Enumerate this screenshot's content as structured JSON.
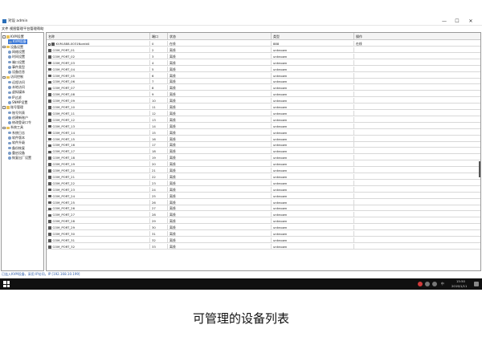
{
  "window": {
    "title": "对设 admin",
    "min_label": "—",
    "max_label": "☐",
    "close_label": "✕"
  },
  "menubar": {
    "items": [
      {
        "label": "文件"
      },
      {
        "label": "视图管理"
      },
      {
        "label": "平台管理"
      },
      {
        "label": "帮助"
      }
    ]
  },
  "tree": {
    "nodes": [
      {
        "label": "KVM设置",
        "level": 0,
        "type": "folder",
        "selected": false,
        "expander": true
      },
      {
        "label": "KVM设备",
        "level": 1,
        "type": "gear",
        "selected": true,
        "expander": false
      },
      {
        "label": "设备设置",
        "level": 0,
        "type": "folder",
        "selected": false,
        "expander": true
      },
      {
        "label": "网络设置",
        "level": 1,
        "type": "gear",
        "selected": false,
        "expander": false
      },
      {
        "label": "时间设置",
        "level": 1,
        "type": "gear",
        "selected": false,
        "expander": false
      },
      {
        "label": "端口设置",
        "level": 1,
        "type": "gear",
        "selected": false,
        "expander": false
      },
      {
        "label": "事件类型",
        "level": 1,
        "type": "gear",
        "selected": false,
        "expander": false
      },
      {
        "label": "设备信息",
        "level": 1,
        "type": "gear",
        "selected": false,
        "expander": false
      },
      {
        "label": "访问控制",
        "level": 0,
        "type": "folder",
        "selected": false,
        "expander": true
      },
      {
        "label": "远程访问",
        "level": 1,
        "type": "gear",
        "selected": false,
        "expander": false
      },
      {
        "label": "本地访问",
        "level": 1,
        "type": "gear",
        "selected": false,
        "expander": false
      },
      {
        "label": "虚拟媒体",
        "level": 1,
        "type": "gear",
        "selected": false,
        "expander": false
      },
      {
        "label": "IP过滤",
        "level": 1,
        "type": "gear",
        "selected": false,
        "expander": false
      },
      {
        "label": "SNMP设置",
        "level": 1,
        "type": "gear",
        "selected": false,
        "expander": false
      },
      {
        "label": "账号管理",
        "level": 0,
        "type": "folder",
        "selected": false,
        "expander": true
      },
      {
        "label": "账号列表",
        "level": 1,
        "type": "gear",
        "selected": false,
        "expander": false
      },
      {
        "label": "创建新账户",
        "level": 1,
        "type": "gear",
        "selected": false,
        "expander": false
      },
      {
        "label": "修改登录口令",
        "level": 1,
        "type": "gear",
        "selected": false,
        "expander": false
      },
      {
        "label": "系统工具",
        "level": 0,
        "type": "folder",
        "selected": false,
        "expander": true
      },
      {
        "label": "系统日志",
        "level": 1,
        "type": "gear",
        "selected": false,
        "expander": false
      },
      {
        "label": "软件版本",
        "level": 1,
        "type": "gear",
        "selected": false,
        "expander": false
      },
      {
        "label": "软件升级",
        "level": 1,
        "type": "gear",
        "selected": false,
        "expander": false
      },
      {
        "label": "备份恢复",
        "level": 1,
        "type": "gear",
        "selected": false,
        "expander": false
      },
      {
        "label": "重启设备",
        "level": 1,
        "type": "gear",
        "selected": false,
        "expander": false
      },
      {
        "label": "恢复出厂设置",
        "level": 1,
        "type": "gear",
        "selected": false,
        "expander": false
      }
    ]
  },
  "table": {
    "columns": [
      {
        "label": "名称"
      },
      {
        "label": "端口"
      },
      {
        "label": "状态"
      },
      {
        "label": "类型"
      },
      {
        "label": "操作"
      }
    ],
    "rows": [
      {
        "name": "KVM-888-0031Nordd4",
        "port": "0",
        "status": "在线",
        "type": "888",
        "action": "在线"
      },
      {
        "name": "COM_PORT_01",
        "port": "2",
        "status": "离线",
        "type": "unknown",
        "action": ""
      },
      {
        "name": "COM_PORT_02",
        "port": "3",
        "status": "离线",
        "type": "unknown",
        "action": ""
      },
      {
        "name": "COM_PORT_03",
        "port": "4",
        "status": "离线",
        "type": "unknown",
        "action": ""
      },
      {
        "name": "COM_PORT_04",
        "port": "5",
        "status": "离线",
        "type": "unknown",
        "action": ""
      },
      {
        "name": "COM_PORT_05",
        "port": "6",
        "status": "离线",
        "type": "unknown",
        "action": ""
      },
      {
        "name": "COM_PORT_06",
        "port": "7",
        "status": "离线",
        "type": "unknown",
        "action": ""
      },
      {
        "name": "COM_PORT_07",
        "port": "8",
        "status": "离线",
        "type": "unknown",
        "action": ""
      },
      {
        "name": "COM_PORT_08",
        "port": "9",
        "status": "离线",
        "type": "unknown",
        "action": ""
      },
      {
        "name": "COM_PORT_09",
        "port": "10",
        "status": "离线",
        "type": "unknown",
        "action": ""
      },
      {
        "name": "COM_PORT_10",
        "port": "11",
        "status": "离线",
        "type": "unknown",
        "action": ""
      },
      {
        "name": "COM_PORT_11",
        "port": "12",
        "status": "离线",
        "type": "unknown",
        "action": ""
      },
      {
        "name": "COM_PORT_12",
        "port": "13",
        "status": "离线",
        "type": "unknown",
        "action": ""
      },
      {
        "name": "COM_PORT_13",
        "port": "14",
        "status": "离线",
        "type": "unknown",
        "action": ""
      },
      {
        "name": "COM_PORT_14",
        "port": "15",
        "status": "离线",
        "type": "unknown",
        "action": ""
      },
      {
        "name": "COM_PORT_15",
        "port": "16",
        "status": "离线",
        "type": "unknown",
        "action": ""
      },
      {
        "name": "COM_PORT_16",
        "port": "17",
        "status": "离线",
        "type": "unknown",
        "action": ""
      },
      {
        "name": "COM_PORT_17",
        "port": "18",
        "status": "离线",
        "type": "unknown",
        "action": ""
      },
      {
        "name": "COM_PORT_18",
        "port": "19",
        "status": "离线",
        "type": "unknown",
        "action": ""
      },
      {
        "name": "COM_PORT_19",
        "port": "20",
        "status": "离线",
        "type": "unknown",
        "action": ""
      },
      {
        "name": "COM_PORT_20",
        "port": "21",
        "status": "离线",
        "type": "unknown",
        "action": ""
      },
      {
        "name": "COM_PORT_21",
        "port": "22",
        "status": "离线",
        "type": "unknown",
        "action": ""
      },
      {
        "name": "COM_PORT_22",
        "port": "23",
        "status": "离线",
        "type": "unknown",
        "action": ""
      },
      {
        "name": "COM_PORT_23",
        "port": "24",
        "status": "离线",
        "type": "unknown",
        "action": ""
      },
      {
        "name": "COM_PORT_24",
        "port": "25",
        "status": "离线",
        "type": "unknown",
        "action": ""
      },
      {
        "name": "COM_PORT_25",
        "port": "26",
        "status": "离线",
        "type": "unknown",
        "action": ""
      },
      {
        "name": "COM_PORT_26",
        "port": "27",
        "status": "离线",
        "type": "unknown",
        "action": ""
      },
      {
        "name": "COM_PORT_27",
        "port": "28",
        "status": "离线",
        "type": "unknown",
        "action": ""
      },
      {
        "name": "COM_PORT_28",
        "port": "29",
        "status": "离线",
        "type": "unknown",
        "action": ""
      },
      {
        "name": "COM_PORT_29",
        "port": "30",
        "status": "离线",
        "type": "unknown",
        "action": ""
      },
      {
        "name": "COM_PORT_30",
        "port": "31",
        "status": "离线",
        "type": "unknown",
        "action": ""
      },
      {
        "name": "COM_PORT_31",
        "port": "32",
        "status": "离线",
        "type": "unknown",
        "action": ""
      },
      {
        "name": "COM_PORT_32",
        "port": "33",
        "status": "离线",
        "type": "unknown",
        "action": ""
      }
    ]
  },
  "statusbar": {
    "text": "已连入KVM设备，采用 IP访问，IP [192.168.10.199]"
  },
  "taskbar": {
    "time": "15:50",
    "date": "2019/1/11",
    "lang": "中"
  },
  "caption": "可管理的设备列表",
  "colors": {
    "selection": "#3b78d8",
    "taskbar": "#101010",
    "status_link": "#2a5aa8"
  }
}
